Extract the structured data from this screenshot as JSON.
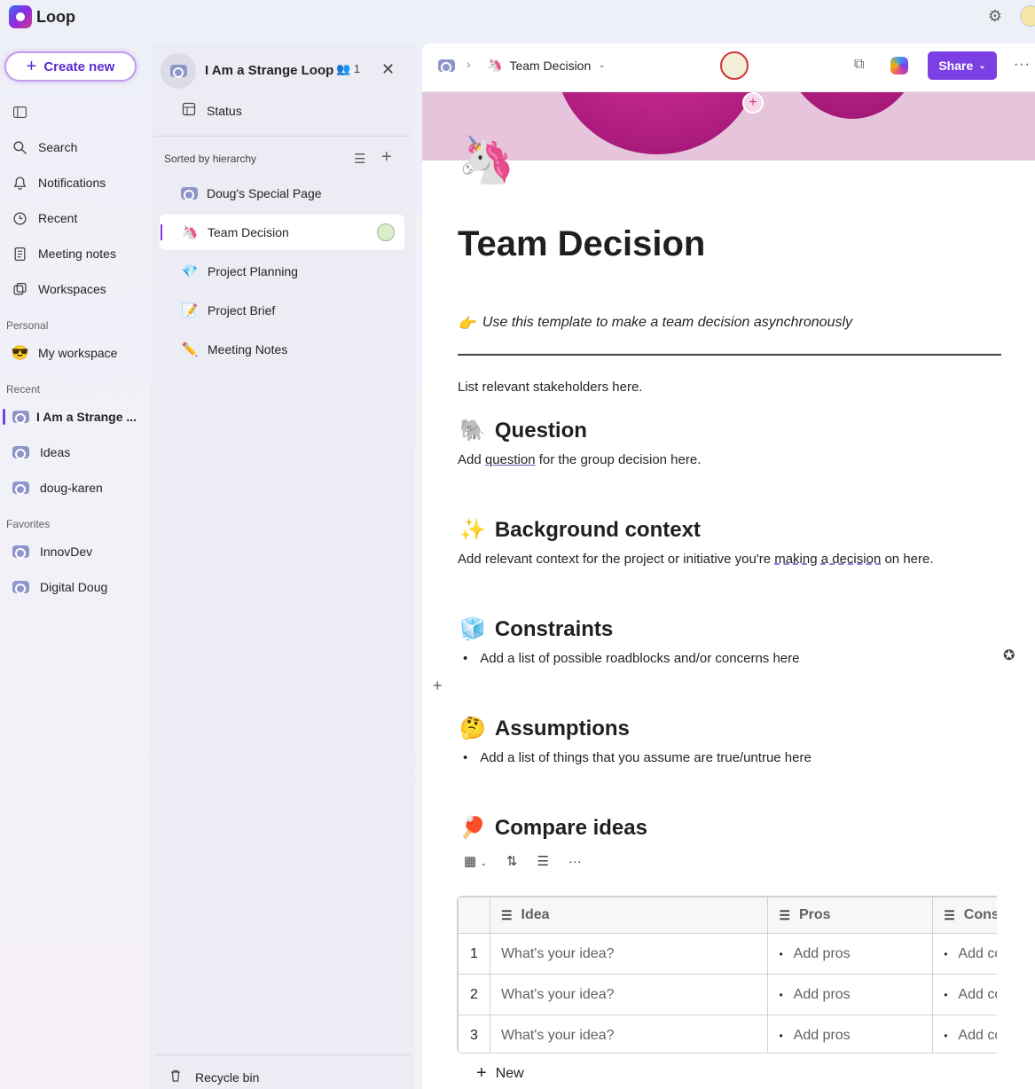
{
  "app": {
    "name": "Loop"
  },
  "nav": {
    "create_label": "Create new",
    "items": [
      {
        "label": "Search"
      },
      {
        "label": "Notifications"
      },
      {
        "label": "Recent"
      },
      {
        "label": "Meeting notes"
      },
      {
        "label": "Workspaces"
      }
    ],
    "personal_label": "Personal",
    "personal_items": [
      {
        "label": "My workspace",
        "emoji": "😎"
      }
    ],
    "recent_label": "Recent",
    "recent_items": [
      {
        "label": "I Am a Strange ..."
      },
      {
        "label": "Ideas"
      },
      {
        "label": "doug-karen"
      }
    ],
    "favorites_label": "Favorites",
    "favorite_items": [
      {
        "label": "InnovDev"
      },
      {
        "label": "Digital Doug"
      }
    ]
  },
  "workspace": {
    "title": "I Am a Strange Loop",
    "member_count": "1",
    "status_label": "Status",
    "sorted_label": "Sorted by hierarchy",
    "pages": [
      {
        "label": "Doug's Special Page",
        "emoji": "📄"
      },
      {
        "label": "Team Decision",
        "emoji": "🦄"
      },
      {
        "label": "Project Planning",
        "emoji": "💎"
      },
      {
        "label": "Project Brief",
        "emoji": "📝"
      },
      {
        "label": "Meeting Notes",
        "emoji": "✏️"
      }
    ],
    "recycle_label": "Recycle bin"
  },
  "header": {
    "page_label": "Team Decision",
    "page_emoji": "🦄",
    "share_label": "Share"
  },
  "page": {
    "icon": "🦄",
    "title": "Team Decision",
    "hint_emoji": "👉",
    "hint": "Use this template to make a team decision asynchronously",
    "stakeholders": "List relevant stakeholders here.",
    "sections": {
      "question": {
        "emoji": "🐘",
        "title": "Question",
        "pre": "Add ",
        "link": "question",
        "post": " for the group decision here."
      },
      "background": {
        "emoji": "✨",
        "title": "Background context",
        "pre": "Add relevant context for the project or initiative you're ",
        "link": "making a decision",
        "post": " on here."
      },
      "constraints": {
        "emoji": "🧊",
        "title": "Constraints",
        "bullet": "Add a list of possible roadblocks and/or concerns here"
      },
      "assumptions": {
        "emoji": "🤔",
        "title": "Assumptions",
        "bullet": "Add a list of things that you assume are true/untrue here"
      },
      "compare": {
        "emoji": "🏓",
        "title": "Compare ideas"
      }
    },
    "table": {
      "headers": [
        "Idea",
        "Pros",
        "Cons"
      ],
      "rows": [
        {
          "num": "1",
          "idea": "What's your idea?",
          "pros": "Add pros",
          "cons": "Add cons"
        },
        {
          "num": "2",
          "idea": "What's your idea?",
          "pros": "Add pros",
          "cons": "Add cons"
        },
        {
          "num": "3",
          "idea": "What's your idea?",
          "pros": "Add pros",
          "cons": "Add cons"
        }
      ],
      "new_label": "New"
    }
  }
}
